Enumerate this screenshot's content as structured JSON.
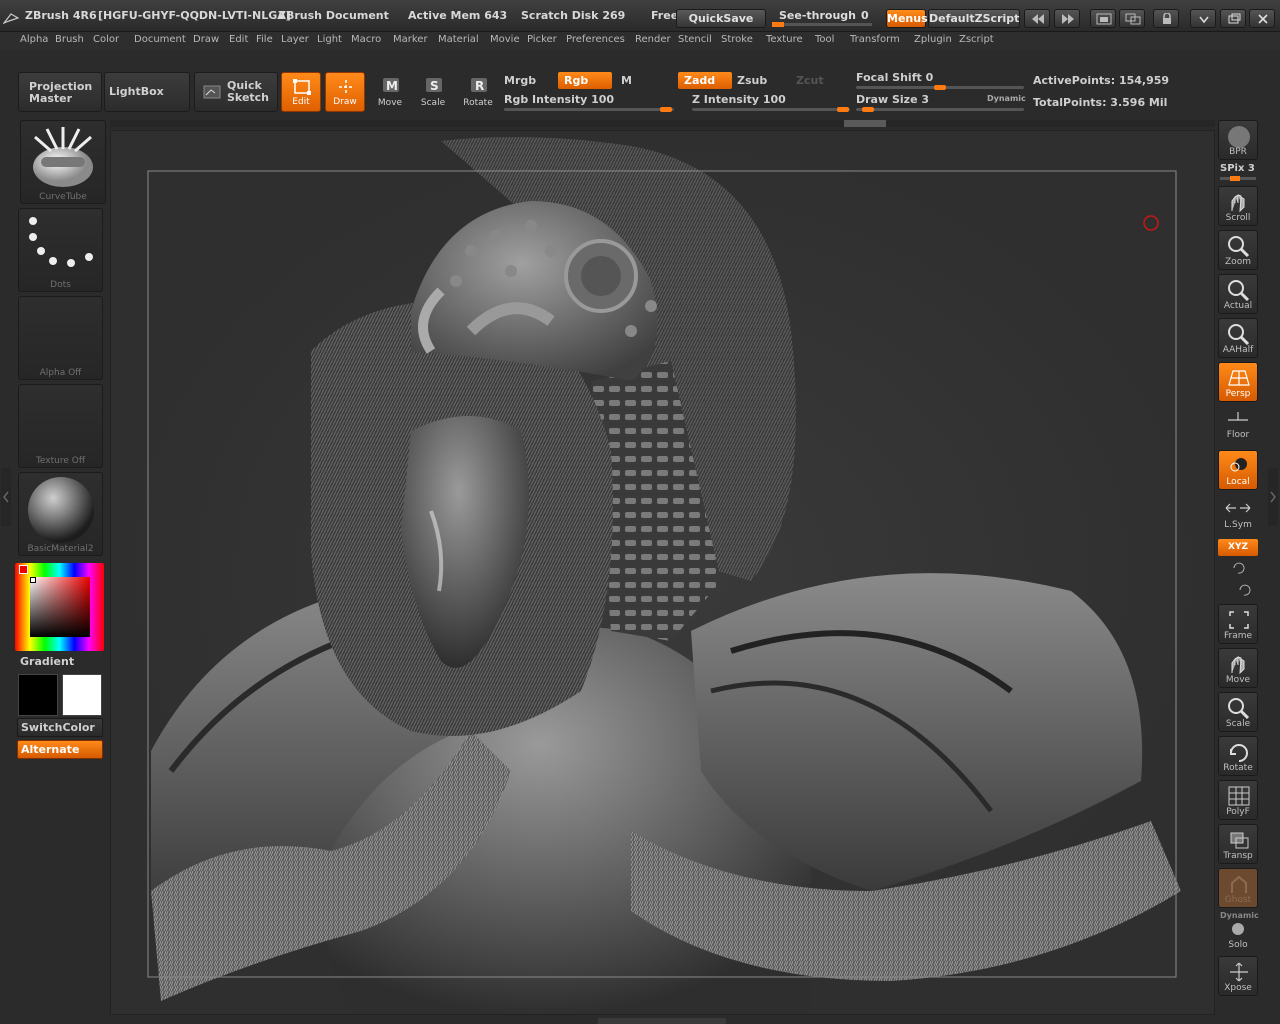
{
  "titlebar": {
    "app": "ZBrush 4R6",
    "serial": "[HGFU-GHYF-QQDN-LVTI-NLGA]",
    "document": "ZBrush Document",
    "active_mem": "Active Mem 643",
    "scratch_disk": "Scratch Disk 269",
    "free": "Free",
    "quicksave": "QuickSave",
    "see_through": "See-through",
    "see_through_value": "0",
    "menus": "Menus",
    "script": "DefaultZScript"
  },
  "menubar": [
    "Alpha",
    "Brush",
    "Color",
    "Document",
    "Draw",
    "Edit",
    "File",
    "Layer",
    "Light",
    "Macro",
    "Marker",
    "Material",
    "Movie",
    "Picker",
    "Preferences",
    "Render",
    "Stencil",
    "Stroke",
    "Texture",
    "Tool",
    "Transform",
    "Zplugin",
    "Zscript"
  ],
  "shelf": {
    "projection_master": "Projection Master",
    "lightbox": "LightBox",
    "quick_sketch": "Quick Sketch",
    "edit": "Edit",
    "draw": "Draw",
    "move": "Move",
    "scale": "Scale",
    "rotate": "Rotate",
    "mrgb": "Mrgb",
    "rgb": "Rgb",
    "m": "M",
    "zadd": "Zadd",
    "zsub": "Zsub",
    "zcut": "Zcut",
    "rgb_intensity": "Rgb Intensity 100",
    "z_intensity": "Z Intensity 100",
    "focal_shift": "Focal Shift 0",
    "draw_size": "Draw Size 3",
    "dynamic": "Dynamic",
    "active_points": "ActivePoints: 154,959",
    "total_points": "TotalPoints: 3.596 Mil"
  },
  "left_tray": {
    "brush": "CurveTube",
    "stroke": "Dots",
    "alpha": "Alpha Off",
    "texture": "Texture Off",
    "material": "BasicMaterial2",
    "gradient": "Gradient",
    "switchcolor": "SwitchColor",
    "alternate": "Alternate"
  },
  "right_tray": {
    "bpr": "BPR",
    "spix": "SPix 3",
    "scroll": "Scroll",
    "zoom": "Zoom",
    "actual": "Actual",
    "aahalf": "AAHalf",
    "persp": "Persp",
    "floor": "Floor",
    "local": "Local",
    "lsym": "L.Sym",
    "xyz": "XYZ",
    "frame": "Frame",
    "move": "Move",
    "scale": "Scale",
    "rotate": "Rotate",
    "polyf": "PolyF",
    "transp": "Transp",
    "ghost": "Ghost",
    "dynamic": "Dynamic",
    "solo": "Solo",
    "xpose": "Xpose"
  },
  "colors": {
    "accent": "#ff7a10",
    "background": "#2b2b2b",
    "main_color": "#000000",
    "secondary_color": "#ffffff"
  }
}
